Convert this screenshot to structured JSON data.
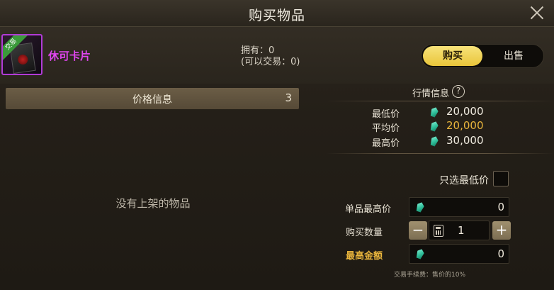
{
  "window": {
    "title": "购买物品"
  },
  "item": {
    "name": "休可卡片",
    "badge": "交易",
    "owned_text": "拥有：0",
    "tradable_text": "(可以交易：0)"
  },
  "mode_toggle": {
    "buy_label": "购买",
    "sell_label": "出售",
    "selected": "buy"
  },
  "price_info": {
    "header": "价格信息",
    "count": "3",
    "empty_text": "没有上架的物品"
  },
  "market": {
    "title": "行情信息",
    "help": "?",
    "stats": [
      {
        "label": "最低价",
        "value": "20,000",
        "color": "#f0ebe0"
      },
      {
        "label": "平均价",
        "value": "20,000",
        "color": "#e9b53c"
      },
      {
        "label": "最高价",
        "value": "30,000",
        "color": "#f0ebe0"
      }
    ],
    "only_lowest_label": "只选最低价"
  },
  "form": {
    "max_unit_price_label": "单品最高价",
    "max_unit_price_value": "0",
    "quantity_label": "购买数量",
    "quantity_value": "1",
    "minus": "−",
    "plus": "+",
    "max_total_label": "最高金额",
    "max_total_value": "0",
    "fee_text": "交易手续费：售价的10%"
  },
  "colors": {
    "accent_gold": "#e9c53a",
    "item_name": "#e046f0",
    "gem": "#2fbf9a"
  }
}
